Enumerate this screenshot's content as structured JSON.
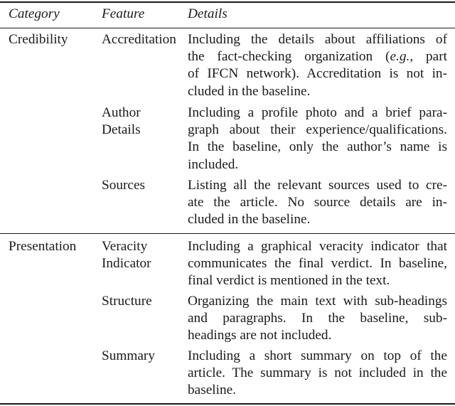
{
  "table": {
    "headers": {
      "category": "Category",
      "feature": "Feature",
      "details": "Details"
    },
    "groups": [
      {
        "category": "Credibility",
        "rows": [
          {
            "feature_lines": [
              "Accreditation"
            ],
            "detail_lines": [
              "Including the details about affiliations of",
              "the fact-checking organization (e.g., part",
              "of IFCN network). Accreditation is not in-",
              "cluded in the baseline."
            ]
          },
          {
            "feature_lines": [
              "Author",
              "Details"
            ],
            "detail_lines": [
              "Including a profile photo and a brief para-",
              "graph about their experience/qualifications.",
              "In the baseline, only the author’s name is",
              "included."
            ]
          },
          {
            "feature_lines": [
              "Sources"
            ],
            "detail_lines": [
              "Listing all the relevant sources used to cre-",
              "ate the article. No source details are in-",
              "cluded in the baseline."
            ]
          }
        ]
      },
      {
        "category": "Presentation",
        "rows": [
          {
            "feature_lines": [
              "Veracity",
              "Indicator"
            ],
            "detail_lines": [
              "Including a graphical veracity indicator that",
              "communicates the final verdict. In baseline,",
              "final verdict is mentioned in the text."
            ]
          },
          {
            "feature_lines": [
              "Structure"
            ],
            "detail_lines": [
              "Organizing the main text with sub-headings",
              "and paragraphs. In the baseline, sub-",
              "headings are not included."
            ]
          },
          {
            "feature_lines": [
              "Summary"
            ],
            "detail_lines": [
              "Including a short summary on top of the",
              "article. The summary is not included in the",
              "baseline."
            ]
          }
        ]
      }
    ]
  }
}
